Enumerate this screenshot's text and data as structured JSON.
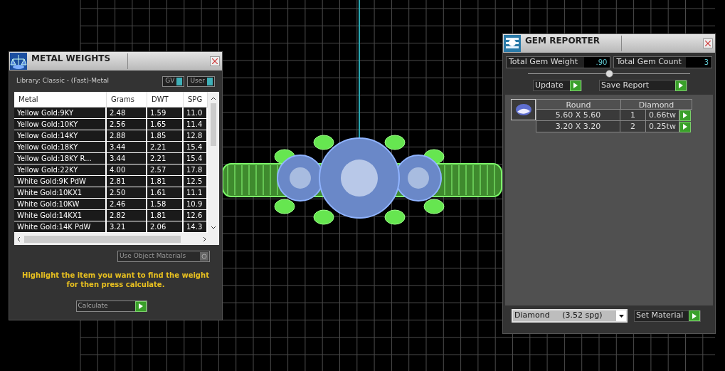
{
  "metal_weights": {
    "title": "METAL WEIGHTS",
    "library": "Library: Classic - (Fast)-Metal",
    "toggles": [
      {
        "label": "GV",
        "on": true
      },
      {
        "label": "User",
        "on": true
      }
    ],
    "columns": [
      "Metal",
      "Grams",
      "DWT",
      "SPG"
    ],
    "rows": [
      [
        "Yellow Gold:9KY",
        "2.48",
        "1.59",
        "11.0"
      ],
      [
        "Yellow Gold:10KY",
        "2.56",
        "1.65",
        "11.4"
      ],
      [
        "Yellow Gold:14KY",
        "2.88",
        "1.85",
        "12.8"
      ],
      [
        "Yellow Gold:18KY",
        "3.44",
        "2.21",
        "15.4"
      ],
      [
        "Yellow Gold:18KY R...",
        "3.44",
        "2.21",
        "15.4"
      ],
      [
        "Yellow Gold:22KY",
        "4.00",
        "2.57",
        "17.8"
      ],
      [
        "White Gold:9K PdW",
        "2.81",
        "1.81",
        "12.5"
      ],
      [
        "White Gold:10KX1",
        "2.50",
        "1.61",
        "11.1"
      ],
      [
        "White Gold:10KW",
        "2.46",
        "1.58",
        "10.9"
      ],
      [
        "White Gold:14KX1",
        "2.82",
        "1.81",
        "12.6"
      ],
      [
        "White Gold:14K PdW",
        "3.21",
        "2.06",
        "14.3"
      ]
    ],
    "use_object_materials": {
      "label": "Use Object Materials",
      "checked": false
    },
    "hint": "Highlight the item you want to find the weight for then press calculate.",
    "calculate_button": "Calculate"
  },
  "gem_reporter": {
    "title": "GEM REPORTER",
    "fields": [
      {
        "label": "Total Gem Weight",
        "value": ".90"
      },
      {
        "label": "Total Gem Count",
        "value": "3"
      }
    ],
    "divider_slider": {
      "level": 0.5
    },
    "buttons": [
      "Update",
      "Save Report"
    ],
    "gem_table": {
      "shape": "Round",
      "material": "Diamond",
      "rows": [
        {
          "size": "5.60 X 5.60",
          "count": "1",
          "weight": "0.66tw"
        },
        {
          "size": "3.20 X 3.20",
          "count": "2",
          "weight": "0.25tw"
        }
      ]
    },
    "material_select": {
      "value": "Diamond     (3.52 spg)"
    },
    "set_material_button": "Set Material"
  }
}
